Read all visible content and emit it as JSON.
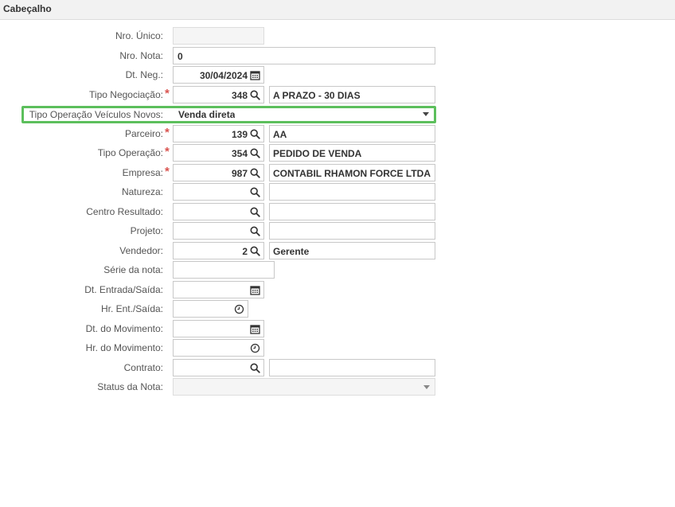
{
  "header": {
    "title": "Cabeçalho"
  },
  "form": {
    "nro_unico": {
      "label": "Nro. Único:",
      "value": ""
    },
    "nro_nota": {
      "label": "Nro. Nota:",
      "value": "0"
    },
    "dt_neg": {
      "label": "Dt. Neg.:",
      "value": "30/04/2024"
    },
    "tipo_negociacao": {
      "label": "Tipo Negociação:",
      "code": "348",
      "description": "A PRAZO - 30 DIAS"
    },
    "tipo_operacao_veiculos": {
      "label": "Tipo Operação Veículos Novos:",
      "value": "Venda direta"
    },
    "parceiro": {
      "label": "Parceiro:",
      "code": "139",
      "description": "AA"
    },
    "tipo_operacao": {
      "label": "Tipo Operação:",
      "code": "354",
      "description": "PEDIDO DE VENDA"
    },
    "empresa": {
      "label": "Empresa:",
      "code": "987",
      "description": "CONTABIL RHAMON FORCE LTDA"
    },
    "natureza": {
      "label": "Natureza:",
      "code": "",
      "description": ""
    },
    "centro_resultado": {
      "label": "Centro Resultado:",
      "code": "",
      "description": ""
    },
    "projeto": {
      "label": "Projeto:",
      "code": "",
      "description": ""
    },
    "vendedor": {
      "label": "Vendedor:",
      "code": "2",
      "description": "Gerente"
    },
    "serie_nota": {
      "label": "Série da nota:",
      "value": ""
    },
    "dt_entrada_saida": {
      "label": "Dt. Entrada/Saída:",
      "value": ""
    },
    "hr_ent_saida": {
      "label": "Hr. Ent./Saída:",
      "value": ""
    },
    "dt_movimento": {
      "label": "Dt. do Movimento:",
      "value": ""
    },
    "hr_movimento": {
      "label": "Hr. do Movimento:",
      "value": ""
    },
    "contrato": {
      "label": "Contrato:",
      "code": "",
      "description": ""
    },
    "status_nota": {
      "label": "Status da Nota:",
      "value": ""
    }
  },
  "required_marker": "*",
  "colors": {
    "required": "#d9534f",
    "highlight": "#5cbf5c"
  },
  "icons": {
    "search": "search-icon",
    "calendar": "calendar-icon",
    "clock": "clock-icon",
    "dropdown": "chevron-down-icon"
  }
}
